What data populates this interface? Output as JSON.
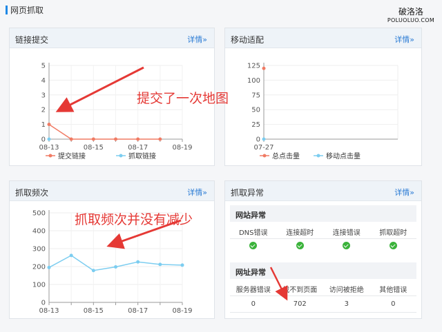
{
  "page": {
    "section_title": "网页抓取"
  },
  "watermark": {
    "main": "破洛洛",
    "sub": "POLUOLUO.COM"
  },
  "cards": {
    "link_submit": {
      "title": "链接提交",
      "detail_link": "详情»"
    },
    "mobile": {
      "title": "移动适配",
      "detail_link": "详情»"
    },
    "crawl_freq": {
      "title": "抓取频次",
      "detail_link": "详情»"
    },
    "crawl_error": {
      "title": "抓取异常",
      "detail_link": "详情»"
    }
  },
  "crawl_error": {
    "site_error": {
      "title": "网站异常",
      "columns": [
        "DNS错误",
        "连接超时",
        "连接错误",
        "抓取超时"
      ],
      "status": [
        "ok",
        "ok",
        "ok",
        "ok"
      ]
    },
    "url_error": {
      "title": "网址异常",
      "columns": [
        "服务器错误",
        "找不到页面",
        "访问被拒绝",
        "其他错误"
      ],
      "values": [
        "0",
        "702",
        "3",
        "0"
      ]
    }
  },
  "annotations": {
    "link_submit_note": "提交了一次地图",
    "crawl_freq_note": "抓取频次并没有减少"
  },
  "colors": {
    "accent": "#1e88e5",
    "link": "#2a7bd4",
    "series_red": "#f07b64",
    "series_blue": "#7ccdf0",
    "ok_green": "#3bb33b",
    "annotation_red": "#e53935"
  },
  "chart_data": [
    {
      "type": "line",
      "x": [
        "08-13",
        "08-14",
        "08-15",
        "08-16",
        "08-17",
        "08-18",
        "08-19"
      ],
      "xticks": [
        "08-13",
        "08-15",
        "08-17",
        "08-19"
      ],
      "ylim": [
        0,
        5
      ],
      "yticks": [
        0,
        1,
        2,
        3,
        4,
        5
      ],
      "series": [
        {
          "name": "提交链接",
          "color": "#f07b64",
          "values": [
            1,
            0,
            0,
            0,
            0,
            0,
            null
          ]
        },
        {
          "name": "抓取链接",
          "color": "#7ccdf0",
          "values": [
            0,
            null,
            null,
            null,
            null,
            null,
            null
          ]
        }
      ]
    },
    {
      "type": "line",
      "x": [
        "07-27"
      ],
      "xticks": [
        "07-27"
      ],
      "ylim": [
        0,
        125
      ],
      "yticks": [
        0,
        25,
        50,
        75,
        100,
        125
      ],
      "series": [
        {
          "name": "总点击量",
          "color": "#f07b64",
          "values": [
            120
          ]
        },
        {
          "name": "移动点击量",
          "color": "#7ccdf0",
          "values": [
            0
          ]
        }
      ]
    },
    {
      "type": "line",
      "x": [
        "08-13",
        "08-14",
        "08-15",
        "08-16",
        "08-17",
        "08-18",
        "08-19"
      ],
      "xticks": [
        "08-13",
        "08-15",
        "08-17",
        "08-19"
      ],
      "ylim": [
        0,
        500
      ],
      "yticks": [
        0,
        100,
        200,
        300,
        400,
        500
      ],
      "series": [
        {
          "name": "",
          "color": "#7ccdf0",
          "values": [
            195,
            262,
            178,
            198,
            226,
            212,
            208
          ]
        }
      ]
    }
  ]
}
